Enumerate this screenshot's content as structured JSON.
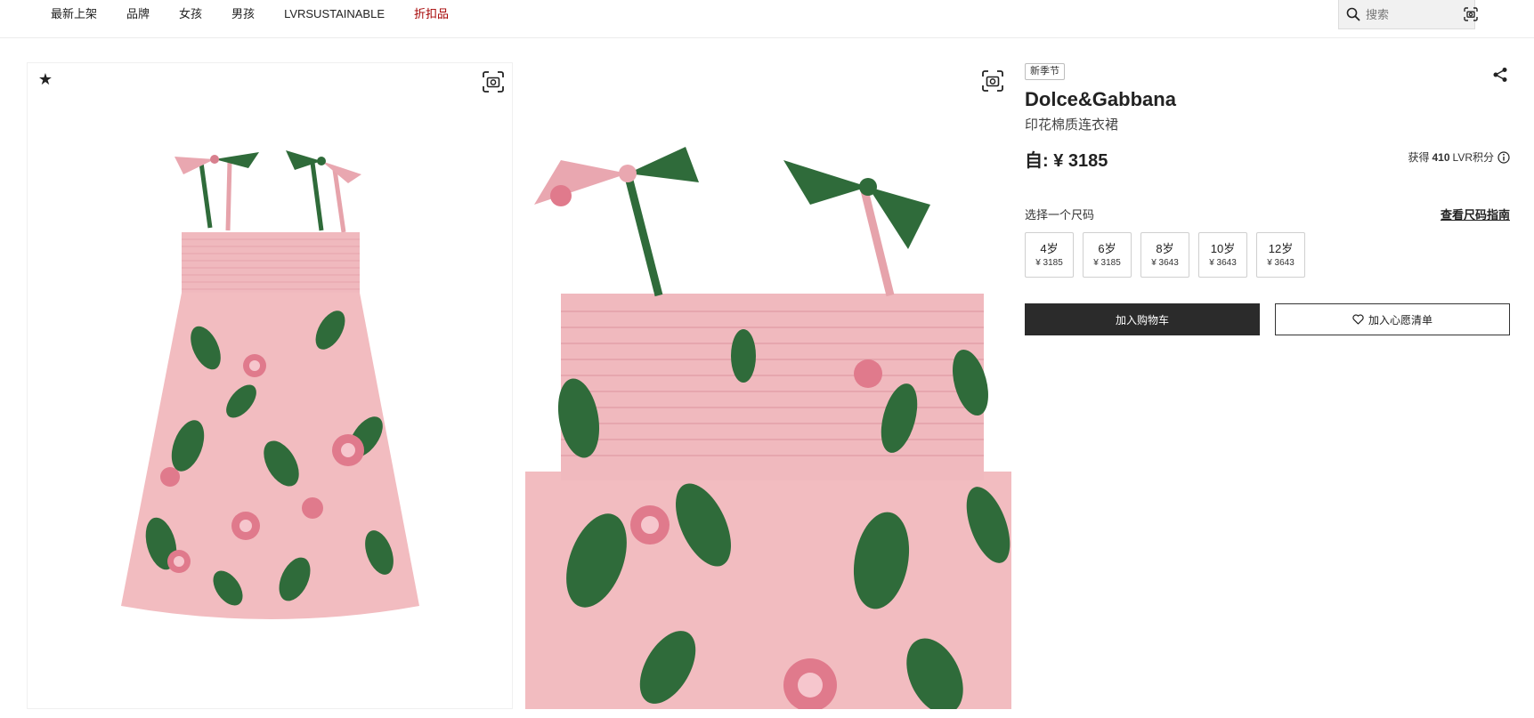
{
  "nav": {
    "links": [
      {
        "label": "最新上架"
      },
      {
        "label": "品牌"
      },
      {
        "label": "女孩"
      },
      {
        "label": "男孩"
      },
      {
        "label": "LVRSUSTAINABLE"
      },
      {
        "label": "折扣品"
      }
    ],
    "sale_color": "#a40000"
  },
  "search": {
    "placeholder": "搜索",
    "icon": "search-icon",
    "visual_search_icon": "camera-scan-icon"
  },
  "gallery": {
    "favorite_icon": "star-icon",
    "zoom_icon": "camera-scan-icon",
    "images": [
      {
        "description_name": "product-image-front"
      },
      {
        "description_name": "product-image-detail"
      }
    ]
  },
  "product": {
    "badge": "新季节",
    "brand": "Dolce&Gabbana",
    "name": "印花棉质连衣裙",
    "price": "自: ¥ 3185",
    "points_prefix": "获得",
    "points_value": "410",
    "points_suffix": "LVR积分",
    "share_icon": "share-icon"
  },
  "sizes": {
    "label": "选择一个尺码",
    "guide_label": "查看尺码指南",
    "options": [
      {
        "size": "4岁",
        "price": "¥ 3185"
      },
      {
        "size": "6岁",
        "price": "¥ 3185"
      },
      {
        "size": "8岁",
        "price": "¥ 3643"
      },
      {
        "size": "10岁",
        "price": "¥ 3643"
      },
      {
        "size": "12岁",
        "price": "¥ 3643"
      }
    ]
  },
  "actions": {
    "add_to_cart": "加入购物车",
    "add_to_wishlist": "加入心愿清单"
  },
  "colors": {
    "dress_pink": "#f2bcc0",
    "leaf_green": "#2f6b3a",
    "rose_pink": "#e07a8c",
    "cart_button": "#2b2b2b"
  }
}
